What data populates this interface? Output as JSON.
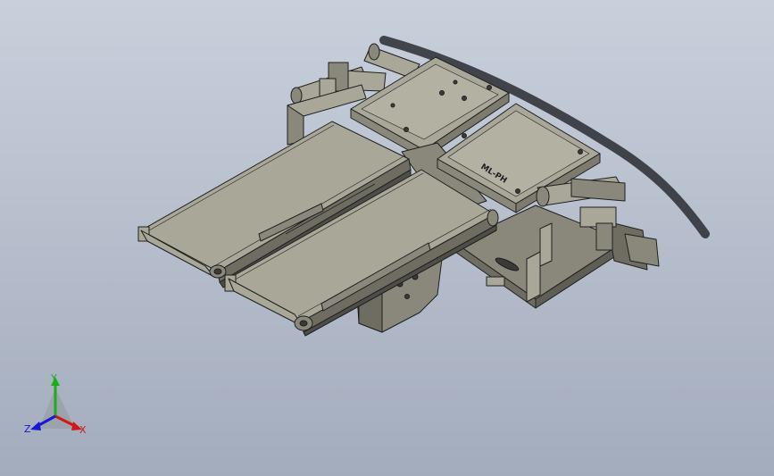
{
  "viewport": {
    "background_top": "#c9d0dc",
    "background_bottom": "#a3acbd"
  },
  "model": {
    "body_color": "#a9a797",
    "shade_color": "#8a887a",
    "dark_color": "#4e4d48",
    "edge_color": "#1f1f1f",
    "plate_label": "ML-PH"
  },
  "triad": {
    "x_label": "X",
    "y_label": "Y",
    "z_label": "Z",
    "x_color": "#d01818",
    "y_color": "#18b018",
    "z_color": "#1818d0"
  }
}
